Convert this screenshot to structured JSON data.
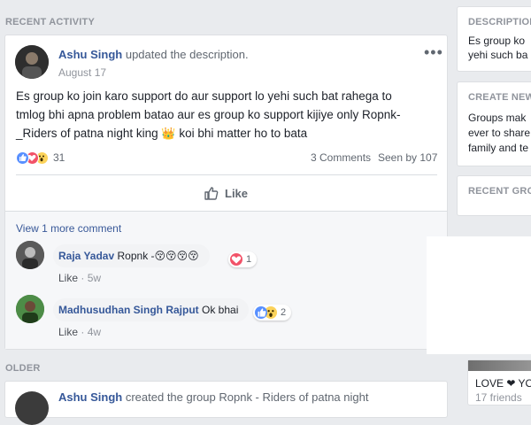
{
  "recent_activity_label": "RECENT ACTIVITY",
  "older_label": "OLDER",
  "post": {
    "author": "Ashu Singh",
    "action": "updated the description.",
    "date": "August 17",
    "body": "Es group ko join karo support do aur support lo yehi such bat rahega to tmlog bhi apna problem batao aur es group ko support kijiye only Ropnk-_Riders of patna night king 👑 koi bhi matter ho to bata",
    "body_line1": "Es group ko join karo support do aur support lo yehi such bat rahega to",
    "body_line2": "tmlog bhi apna problem batao aur es group ko support kijiye only Ropnk-",
    "body_line3a": "_Riders of patna night king",
    "body_line3b": "koi bhi matter ho to bata",
    "reaction_count": "31",
    "comments_count": "3 Comments",
    "seen_by": "Seen by 107",
    "like_label": "Like",
    "view_more": "View 1 more comment"
  },
  "comments": [
    {
      "author": "Raja Yadav",
      "text": "Ropnk -",
      "emojis": "😚😚😚😚",
      "like": "Like",
      "time": "5w",
      "reaction_count": "1"
    },
    {
      "author": "Madhusudhan Singh Rajput",
      "text": "Ok bhai",
      "like": "Like",
      "time": "4w",
      "reaction_count": "2"
    }
  ],
  "older_post": {
    "author": "Ashu Singh",
    "action": "created the group Ropnk - Riders of patna night"
  },
  "sidebar": {
    "description_title": "DESCRIPTION",
    "description_line1": "Es group ko",
    "description_line2": "yehi such ba",
    "create_title": "CREATE NEW",
    "create_line1": "Groups mak",
    "create_line2": "ever to share",
    "create_line3": "family and te",
    "recent_groups_title": "RECENT GRO",
    "group_name": "LOVE ❤ YO",
    "group_friends": "17 friends"
  },
  "colors": {
    "link": "#365899",
    "background": "#e9ebee",
    "muted": "#90949c"
  }
}
